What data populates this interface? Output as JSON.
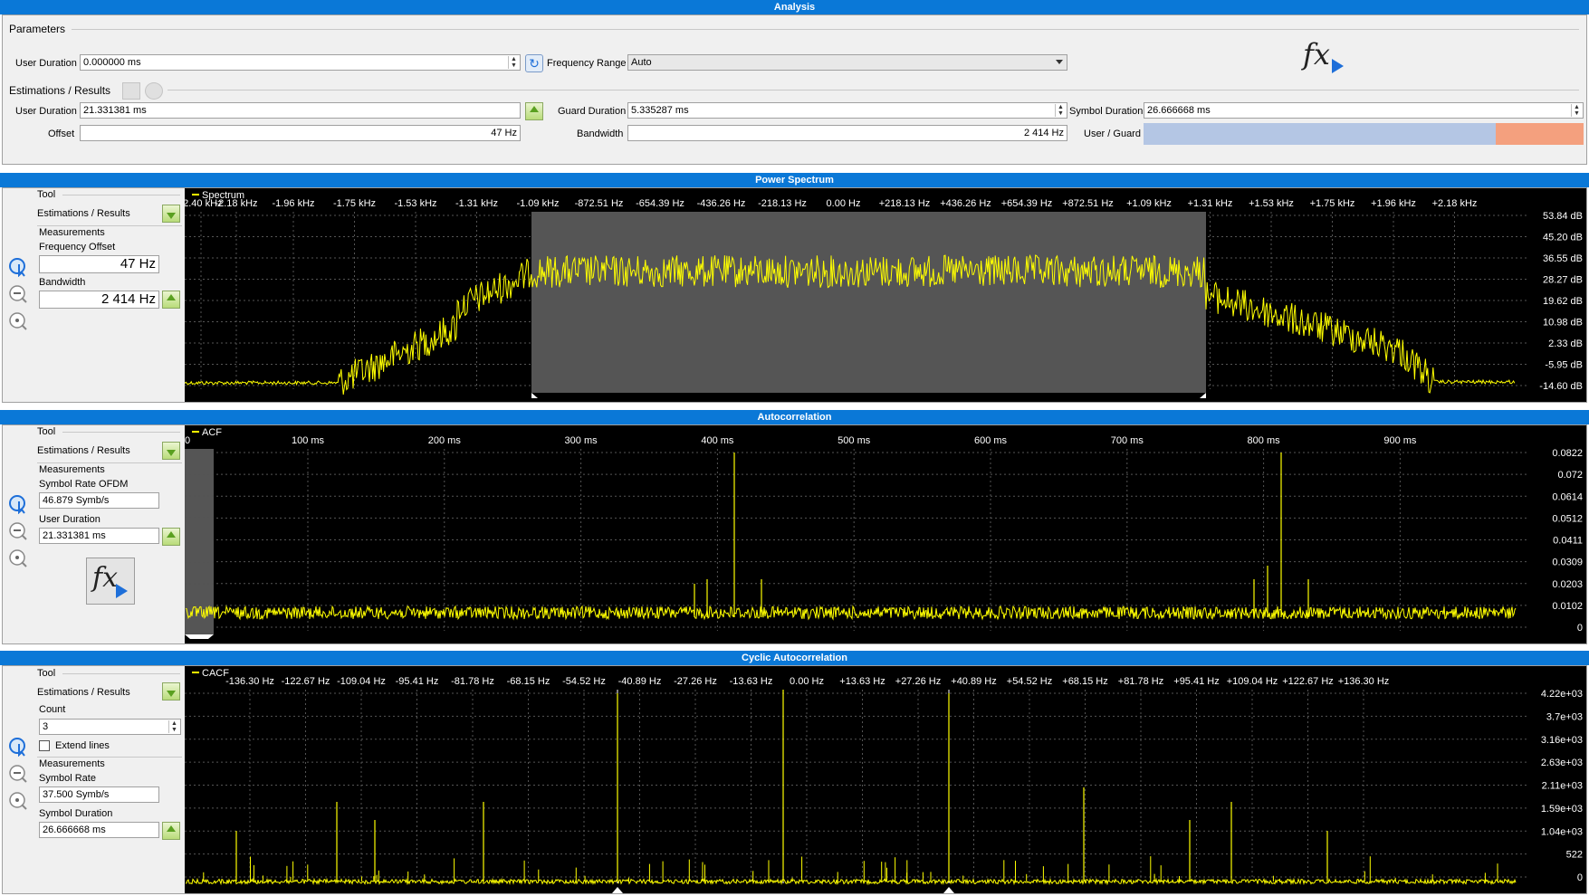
{
  "analysis": {
    "title": "Analysis",
    "parameters_label": "Parameters",
    "user_duration_label": "User Duration",
    "user_duration_value": "0.000000 ms",
    "frequency_range_label": "Frequency Range",
    "frequency_range_value": "Auto",
    "fx_icon": "fx-play-icon",
    "estimations_label": "Estimations / Results",
    "est_user_duration_label": "User Duration",
    "est_user_duration_value": "21.331381 ms",
    "guard_duration_label": "Guard Duration",
    "guard_duration_value": "5.335287 ms",
    "symbol_duration_label": "Symbol Duration",
    "symbol_duration_value": "26.666668 ms",
    "offset_label": "Offset",
    "offset_value": "47 Hz",
    "bandwidth_label": "Bandwidth",
    "bandwidth_value": "2 414 Hz",
    "user_guard_label": "User / Guard",
    "user_guard_ratio": 0.8,
    "user_color": "#b4c6e4",
    "guard_color": "#f4a07e"
  },
  "power_spectrum": {
    "title": "Power Spectrum",
    "tool_label": "Tool",
    "estimations_label": "Estimations / Results",
    "measurements_label": "Measurements",
    "freq_offset_label": "Frequency Offset",
    "freq_offset_value": "47 Hz",
    "bandwidth_label": "Bandwidth",
    "bandwidth_value": "2 414 Hz",
    "legend": "Spectrum",
    "x_ticks": [
      "-2.40 kHz",
      "-2.18 kHz",
      "-1.96 kHz",
      "-1.75 kHz",
      "-1.53 kHz",
      "-1.31 kHz",
      "-1.09 kHz",
      "-872.51 Hz",
      "-654.39 Hz",
      "-436.26 Hz",
      "-218.13 Hz",
      "0.00 Hz",
      "+218.13 Hz",
      "+436.26 Hz",
      "+654.39 Hz",
      "+872.51 Hz",
      "+1.09 kHz",
      "+1.31 kHz",
      "+1.53 kHz",
      "+1.75 kHz",
      "+1.96 kHz",
      "+2.18 kHz"
    ],
    "y_ticks": [
      "53.84 dB",
      "45.20 dB",
      "36.55 dB",
      "28.27 dB",
      "19.62 dB",
      "10.98 dB",
      "2.33 dB",
      "-5.95 dB",
      "-14.60 dB"
    ]
  },
  "autocorrelation": {
    "title": "Autocorrelation",
    "tool_label": "Tool",
    "estimations_label": "Estimations / Results",
    "measurements_label": "Measurements",
    "symbol_rate_label": "Symbol Rate OFDM",
    "symbol_rate_value": "46.879 Symb/s",
    "user_duration_label": "User Duration",
    "user_duration_value": "21.331381 ms",
    "legend": "ACF",
    "x_ticks": [
      "0",
      "100 ms",
      "200 ms",
      "300 ms",
      "400 ms",
      "500 ms",
      "600 ms",
      "700 ms",
      "800 ms",
      "900 ms"
    ],
    "y_ticks": [
      "0.0822",
      "0.072",
      "0.0614",
      "0.0512",
      "0.0411",
      "0.0309",
      "0.0203",
      "0.0102",
      "0"
    ]
  },
  "cyclic": {
    "title": "Cyclic Autocorrelation",
    "tool_label": "Tool",
    "estimations_label": "Estimations / Results",
    "count_label": "Count",
    "count_value": "3",
    "extend_lines_label": "Extend lines",
    "measurements_label": "Measurements",
    "symbol_rate_label": "Symbol Rate",
    "symbol_rate_value": "37.500 Symb/s",
    "symbol_duration_label": "Symbol Duration",
    "symbol_duration_value": "26.666668 ms",
    "legend": "CACF",
    "x_ticks": [
      "-136.30 Hz",
      "-122.67 Hz",
      "-109.04 Hz",
      "-95.41 Hz",
      "-81.78 Hz",
      "-68.15 Hz",
      "-54.52 Hz",
      "-40.89 Hz",
      "-27.26 Hz",
      "-13.63 Hz",
      "0.00 Hz",
      "+13.63 Hz",
      "+27.26 Hz",
      "+40.89 Hz",
      "+54.52 Hz",
      "+68.15 Hz",
      "+81.78 Hz",
      "+95.41 Hz",
      "+109.04 Hz",
      "+122.67 Hz",
      "+136.30 Hz"
    ],
    "y_ticks": [
      "4.22e+03",
      "3.7e+03",
      "3.16e+03",
      "2.63e+03",
      "2.11e+03",
      "1.59e+03",
      "1.04e+03",
      "522",
      "0"
    ]
  },
  "trace_color": "#ffff00"
}
